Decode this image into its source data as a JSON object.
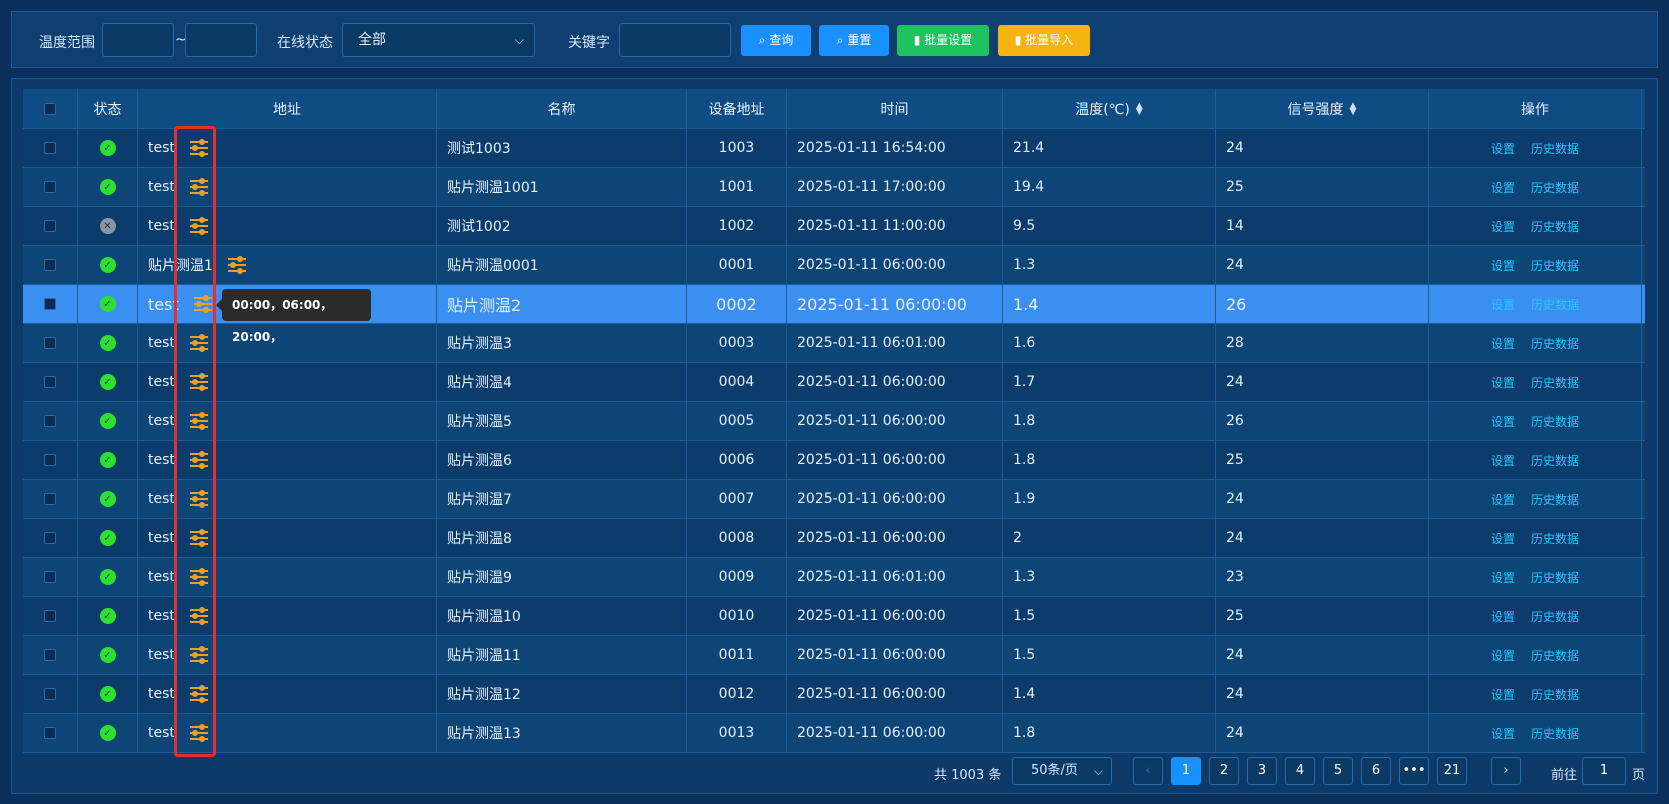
{
  "filters": {
    "temp_range_label": "温度范围",
    "temp_min": "",
    "temp_max": "",
    "range_sep": "~",
    "online_label": "在线状态",
    "online_value": "全部",
    "keyword_label": "关键字",
    "keyword_value": ""
  },
  "buttons": {
    "query": "查询",
    "reset": "重置",
    "batch_set": "批量设置",
    "batch_import": "批量导入"
  },
  "columns": {
    "status": "状态",
    "address": "地址",
    "name": "名称",
    "device_address": "设备地址",
    "time": "时间",
    "temperature": "温度(℃)",
    "signal": "信号强度",
    "actions": "操作"
  },
  "actions": {
    "settings": "设置",
    "history": "历史数据"
  },
  "rows": [
    {
      "status": "online",
      "address": "test",
      "name": "测试1003",
      "dev": "1003",
      "time": "2025-01-11 16:54:00",
      "temp": "21.4",
      "signal": "24"
    },
    {
      "status": "online",
      "address": "test",
      "name": "贴片测温1001",
      "dev": "1001",
      "time": "2025-01-11 17:00:00",
      "temp": "19.4",
      "signal": "25"
    },
    {
      "status": "offline",
      "address": "test",
      "name": "测试1002",
      "dev": "1002",
      "time": "2025-01-11 11:00:00",
      "temp": "9.5",
      "signal": "14"
    },
    {
      "status": "online",
      "address": "贴片测温1",
      "name": "贴片测温0001",
      "dev": "0001",
      "time": "2025-01-11 06:00:00",
      "temp": "1.3",
      "signal": "24"
    },
    {
      "status": "online",
      "address": "test",
      "name": "贴片测温2",
      "dev": "0002",
      "time": "2025-01-11 06:00:00",
      "temp": "1.4",
      "signal": "26"
    },
    {
      "status": "online",
      "address": "test",
      "name": "贴片测温3",
      "dev": "0003",
      "time": "2025-01-11 06:01:00",
      "temp": "1.6",
      "signal": "28"
    },
    {
      "status": "online",
      "address": "test",
      "name": "贴片测温4",
      "dev": "0004",
      "time": "2025-01-11 06:00:00",
      "temp": "1.7",
      "signal": "24"
    },
    {
      "status": "online",
      "address": "test",
      "name": "贴片测温5",
      "dev": "0005",
      "time": "2025-01-11 06:00:00",
      "temp": "1.8",
      "signal": "26"
    },
    {
      "status": "online",
      "address": "test",
      "name": "贴片测温6",
      "dev": "0006",
      "time": "2025-01-11 06:00:00",
      "temp": "1.8",
      "signal": "25"
    },
    {
      "status": "online",
      "address": "test",
      "name": "贴片测温7",
      "dev": "0007",
      "time": "2025-01-11 06:00:00",
      "temp": "1.9",
      "signal": "24"
    },
    {
      "status": "online",
      "address": "test",
      "name": "贴片测温8",
      "dev": "0008",
      "time": "2025-01-11 06:00:00",
      "temp": "2",
      "signal": "24"
    },
    {
      "status": "online",
      "address": "test",
      "name": "贴片测温9",
      "dev": "0009",
      "time": "2025-01-11 06:01:00",
      "temp": "1.3",
      "signal": "23"
    },
    {
      "status": "online",
      "address": "test",
      "name": "贴片测温10",
      "dev": "0010",
      "time": "2025-01-11 06:00:00",
      "temp": "1.5",
      "signal": "25"
    },
    {
      "status": "online",
      "address": "test",
      "name": "贴片测温11",
      "dev": "0011",
      "time": "2025-01-11 06:00:00",
      "temp": "1.5",
      "signal": "24"
    },
    {
      "status": "online",
      "address": "test",
      "name": "贴片测温12",
      "dev": "0012",
      "time": "2025-01-11 06:00:00",
      "temp": "1.4",
      "signal": "24"
    },
    {
      "status": "online",
      "address": "test",
      "name": "贴片测温13",
      "dev": "0013",
      "time": "2025-01-11 06:00:00",
      "temp": "1.8",
      "signal": "24"
    }
  ],
  "selected_row": 4,
  "tooltip": "00:00，06:00，20:00，",
  "pagination": {
    "total": "共 1003 条",
    "page_size": "50条/页",
    "pages": [
      "1",
      "2",
      "3",
      "4",
      "5",
      "6",
      "•••",
      "21"
    ],
    "current": "1",
    "goto_label": "前往",
    "goto_value": "1",
    "goto_unit": "页"
  },
  "colors": {
    "background": "#0b2f5c",
    "online": "#2de02d",
    "offline": "#8a96a6",
    "selected_row": "#3a8ff0",
    "link": "#2bc4ff",
    "addr_icon": "#f0a020",
    "highlight_box": "#e23030"
  },
  "icons": {
    "address_config": "sliders-icon",
    "online": "check-circle-icon",
    "offline": "x-circle-icon"
  }
}
